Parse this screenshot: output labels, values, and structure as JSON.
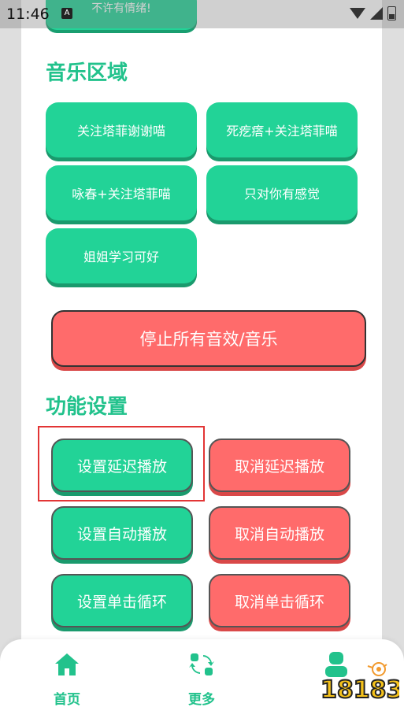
{
  "status_bar": {
    "time": "11:46",
    "notification_icon": "a-icon"
  },
  "top_partial_button": {
    "label": "不许有情绪!"
  },
  "music_section": {
    "title": "音乐区域",
    "buttons": [
      {
        "label": "关注塔菲谢谢喵"
      },
      {
        "label": "死疙瘩+关注塔菲喵"
      },
      {
        "label": "咏春+关注塔菲喵"
      },
      {
        "label": "只对你有感觉"
      },
      {
        "label": "姐姐学习可好"
      }
    ]
  },
  "stop_button": {
    "label": "停止所有音效/音乐"
  },
  "function_section": {
    "title": "功能设置",
    "buttons": [
      {
        "left": "设置延迟播放",
        "right": "取消延迟播放"
      },
      {
        "left": "设置自动播放",
        "right": "取消自动播放"
      },
      {
        "left": "设置单击循环",
        "right": "取消单击循环"
      }
    ]
  },
  "bottom_nav": {
    "items": [
      {
        "label": "首页",
        "icon": "home-icon"
      },
      {
        "label": "更多",
        "icon": "swap-icon"
      },
      {
        "label": "",
        "icon": "user-icon"
      }
    ]
  },
  "watermark": {
    "text": "18183"
  },
  "colors": {
    "green": "#22d397",
    "red": "#ff6b6b",
    "title_green": "#22c28c"
  }
}
